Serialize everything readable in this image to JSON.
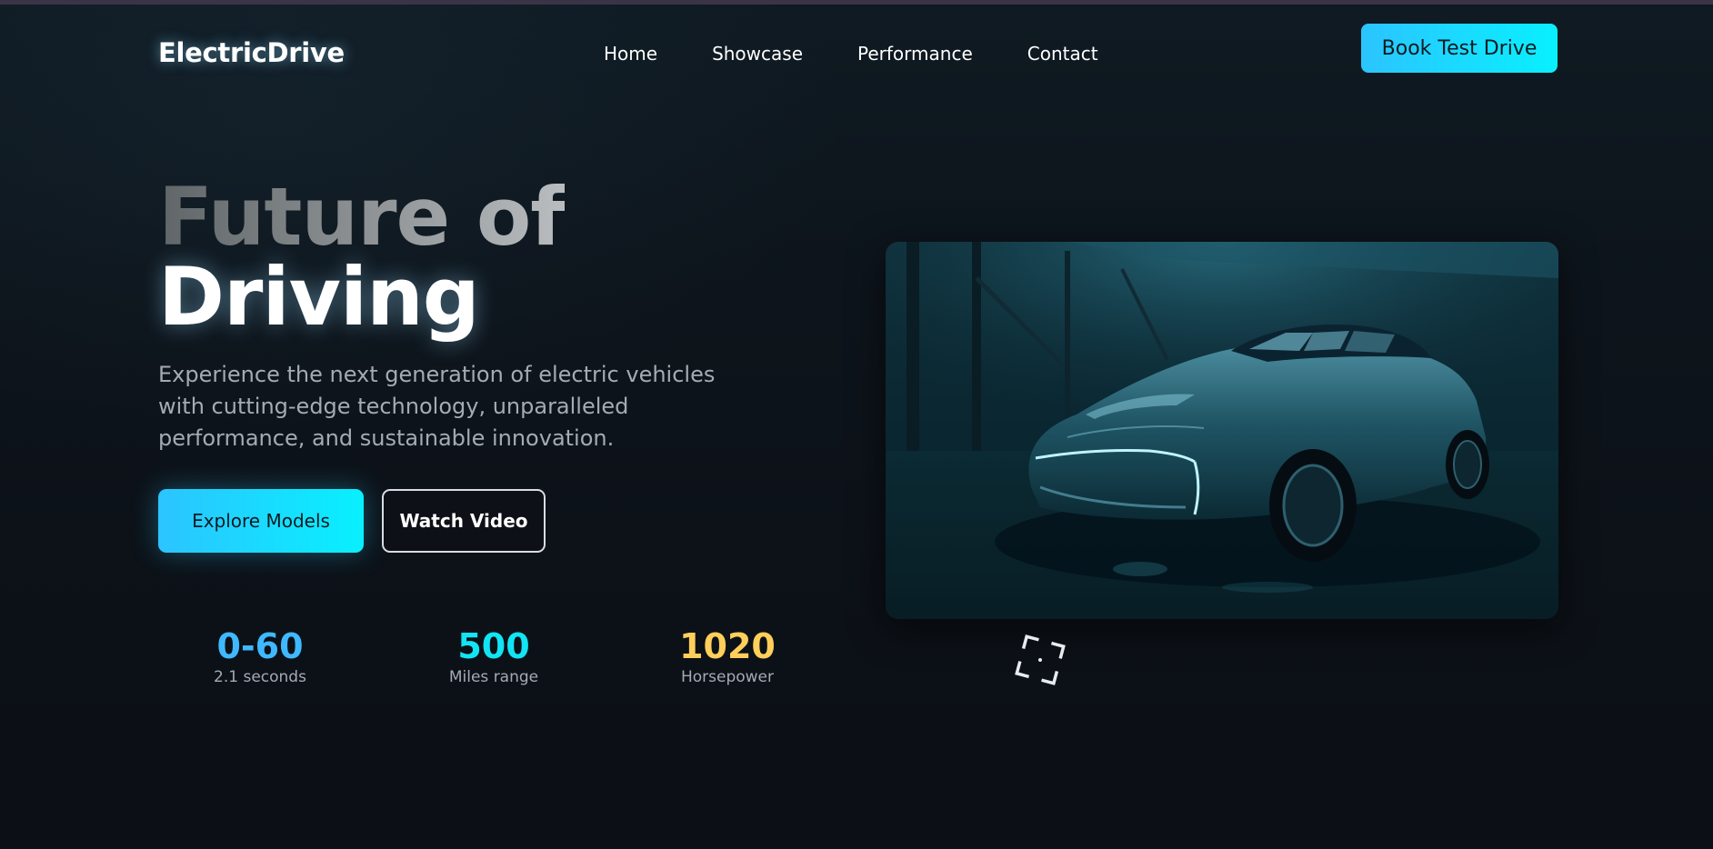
{
  "nav": {
    "brand": "ElectricDrive",
    "links": [
      {
        "label": "Home"
      },
      {
        "label": "Showcase"
      },
      {
        "label": "Performance"
      },
      {
        "label": "Contact"
      }
    ],
    "cta": "Book Test Drive"
  },
  "hero": {
    "title_line1": "Future of",
    "title_line2": "Driving",
    "subtitle": "Experience the next generation of electric vehicles with cutting-edge technology, unparalleled performance, and sustainable innovation.",
    "primary_button": "Explore Models",
    "secondary_button": "Watch Video"
  },
  "stats": [
    {
      "value": "0-60",
      "label": "2.1 seconds",
      "color": "#3fb8ff"
    },
    {
      "value": "500",
      "label": "Miles range",
      "color": "#12e4f4"
    },
    {
      "value": "1020",
      "label": "Horsepower",
      "color": "#ffcf5a"
    }
  ],
  "icons": {
    "focus": "focus-frame-icon"
  },
  "colors": {
    "accent_start": "#2cc4ff",
    "accent_end": "#08f0ff",
    "background": "#0d1117"
  }
}
